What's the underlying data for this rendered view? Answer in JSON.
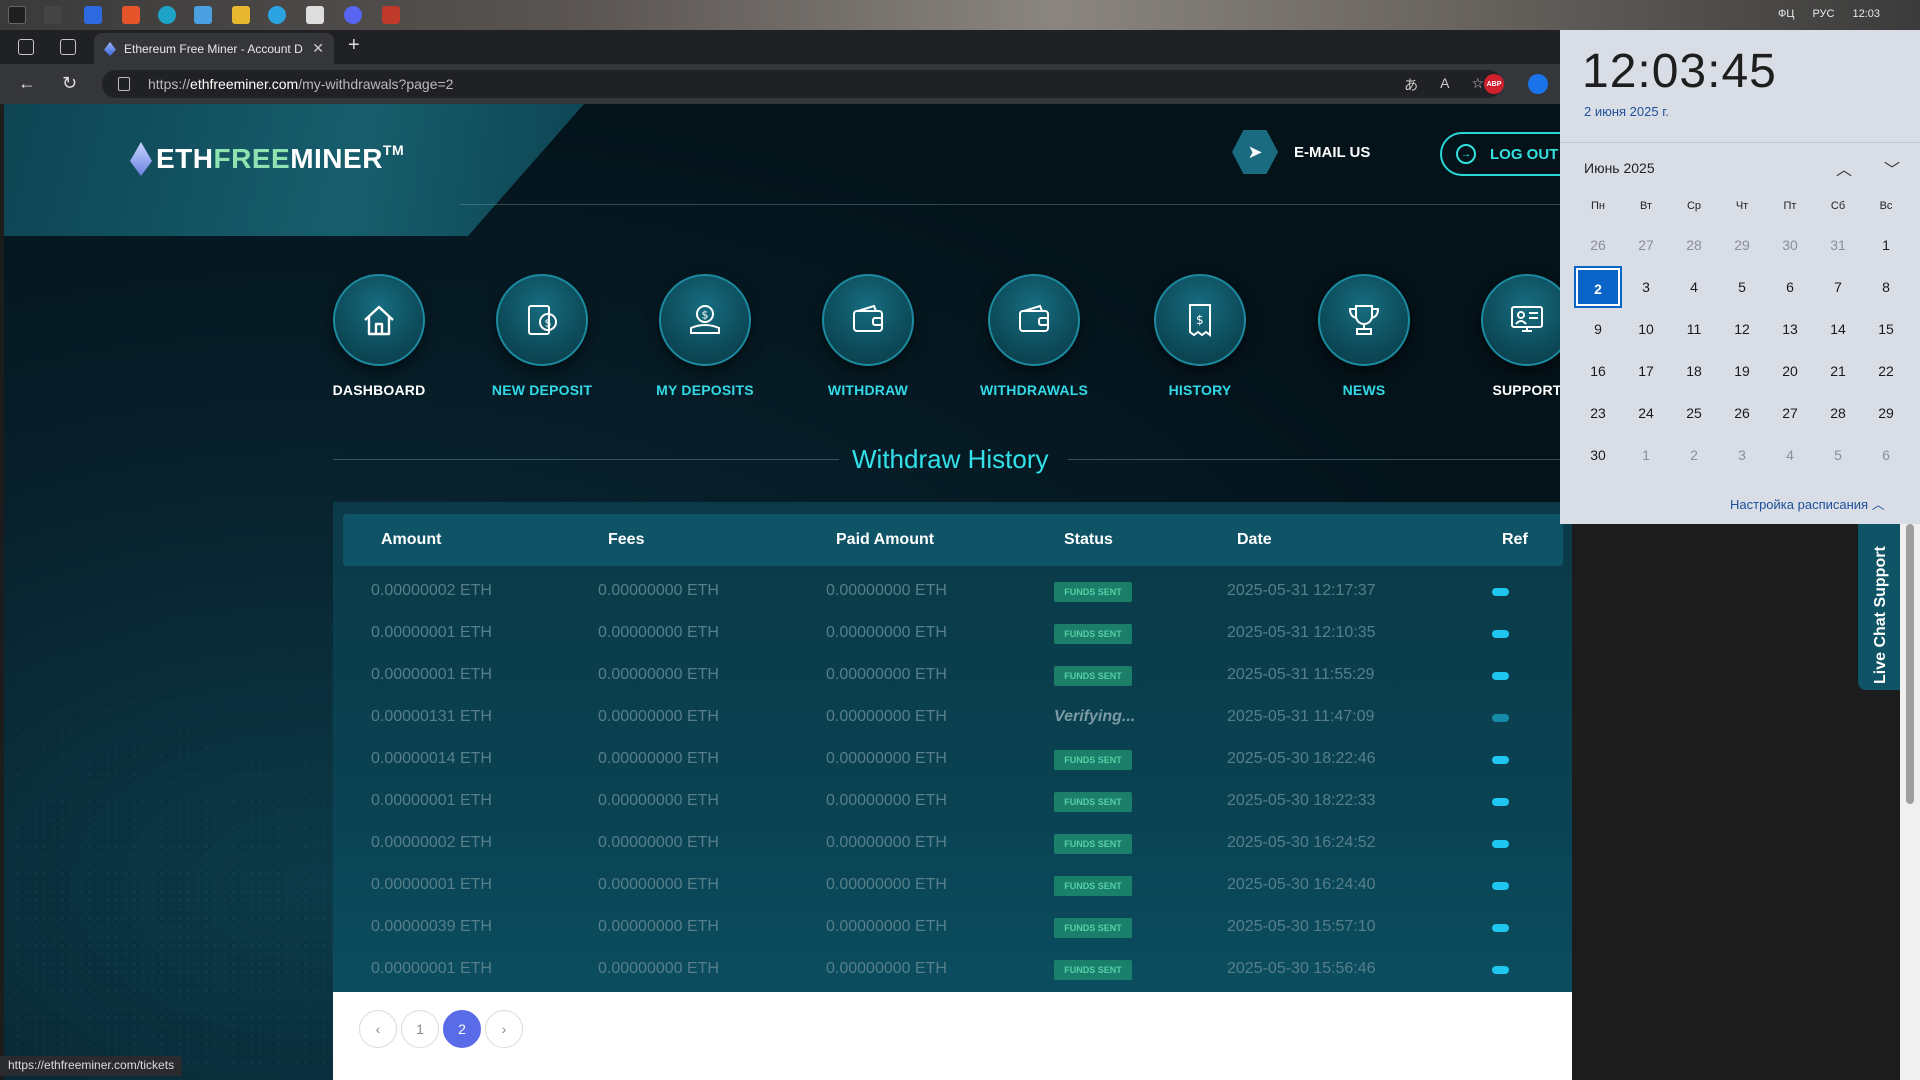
{
  "taskbar": {
    "tray": [
      "ФЦ",
      "РУС",
      "12:03"
    ]
  },
  "browser": {
    "tab_title": "Ethereum Free Miner - Account D",
    "url_prefix": "https://",
    "url_host": "ethfreeminer.com",
    "url_path": "/my-withdrawals?page=2",
    "ext_abp": "ABP",
    "status_url": "https://ethfreeminer.com/tickets"
  },
  "site": {
    "logo_eth": "ETH",
    "logo_free": "FREE",
    "logo_miner": "MINER",
    "logo_tm": "TM",
    "email_label": "E-MAIL US",
    "logout_label": "LOG OUT"
  },
  "nav": [
    {
      "label": "DASHBOARD",
      "icon": "home-icon"
    },
    {
      "label": "NEW DEPOSIT",
      "icon": "deposit-icon"
    },
    {
      "label": "MY DEPOSITS",
      "icon": "coins-hand-icon"
    },
    {
      "label": "WITHDRAW",
      "icon": "wallet-icon"
    },
    {
      "label": "WITHDRAWALS",
      "icon": "wallet-icon"
    },
    {
      "label": "HISTORY",
      "icon": "receipt-icon"
    },
    {
      "label": "NEWS",
      "icon": "trophy-icon"
    },
    {
      "label": "SUPPORT",
      "icon": "support-icon"
    }
  ],
  "section_title": "Withdraw History",
  "table": {
    "headers": [
      "Amount",
      "Fees",
      "Paid Amount",
      "Status",
      "Date",
      "Ref"
    ],
    "rows": [
      {
        "amount": "0.00000002 ETH",
        "fees": "0.00000000 ETH",
        "paid": "0.00000000 ETH",
        "status": "FUNDS SENT",
        "date": "2025-05-31 12:17:37"
      },
      {
        "amount": "0.00000001 ETH",
        "fees": "0.00000000 ETH",
        "paid": "0.00000000 ETH",
        "status": "FUNDS SENT",
        "date": "2025-05-31 12:10:35"
      },
      {
        "amount": "0.00000001 ETH",
        "fees": "0.00000000 ETH",
        "paid": "0.00000000 ETH",
        "status": "FUNDS SENT",
        "date": "2025-05-31 11:55:29"
      },
      {
        "amount": "0.00000131 ETH",
        "fees": "0.00000000 ETH",
        "paid": "0.00000000 ETH",
        "status": "Verifying...",
        "date": "2025-05-31 11:47:09"
      },
      {
        "amount": "0.00000014 ETH",
        "fees": "0.00000000 ETH",
        "paid": "0.00000000 ETH",
        "status": "FUNDS SENT",
        "date": "2025-05-30 18:22:46"
      },
      {
        "amount": "0.00000001 ETH",
        "fees": "0.00000000 ETH",
        "paid": "0.00000000 ETH",
        "status": "FUNDS SENT",
        "date": "2025-05-30 18:22:33"
      },
      {
        "amount": "0.00000002 ETH",
        "fees": "0.00000000 ETH",
        "paid": "0.00000000 ETH",
        "status": "FUNDS SENT",
        "date": "2025-05-30 16:24:52"
      },
      {
        "amount": "0.00000001 ETH",
        "fees": "0.00000000 ETH",
        "paid": "0.00000000 ETH",
        "status": "FUNDS SENT",
        "date": "2025-05-30 16:24:40"
      },
      {
        "amount": "0.00000039 ETH",
        "fees": "0.00000000 ETH",
        "paid": "0.00000000 ETH",
        "status": "FUNDS SENT",
        "date": "2025-05-30 15:57:10"
      },
      {
        "amount": "0.00000001 ETH",
        "fees": "0.00000000 ETH",
        "paid": "0.00000000 ETH",
        "status": "FUNDS SENT",
        "date": "2025-05-30 15:56:46"
      }
    ]
  },
  "pager": {
    "prev": "‹",
    "pages": [
      "1",
      "2"
    ],
    "current": "2",
    "next": "›"
  },
  "live_chat": "Live Chat Support",
  "calendar": {
    "time": "12:03:45",
    "date": "2 июня 2025 г.",
    "month": "Июнь 2025",
    "weekdays": [
      "Пн",
      "Вт",
      "Ср",
      "Чт",
      "Пт",
      "Сб",
      "Вс"
    ],
    "days": [
      [
        "26",
        "27",
        "28",
        "29",
        "30",
        "31",
        "1"
      ],
      [
        "2",
        "3",
        "4",
        "5",
        "6",
        "7",
        "8"
      ],
      [
        "9",
        "10",
        "11",
        "12",
        "13",
        "14",
        "15"
      ],
      [
        "16",
        "17",
        "18",
        "19",
        "20",
        "21",
        "22"
      ],
      [
        "23",
        "24",
        "25",
        "26",
        "27",
        "28",
        "29"
      ],
      [
        "30",
        "1",
        "2",
        "3",
        "4",
        "5",
        "6"
      ]
    ],
    "today": "2",
    "footer": "Настройка расписания"
  }
}
